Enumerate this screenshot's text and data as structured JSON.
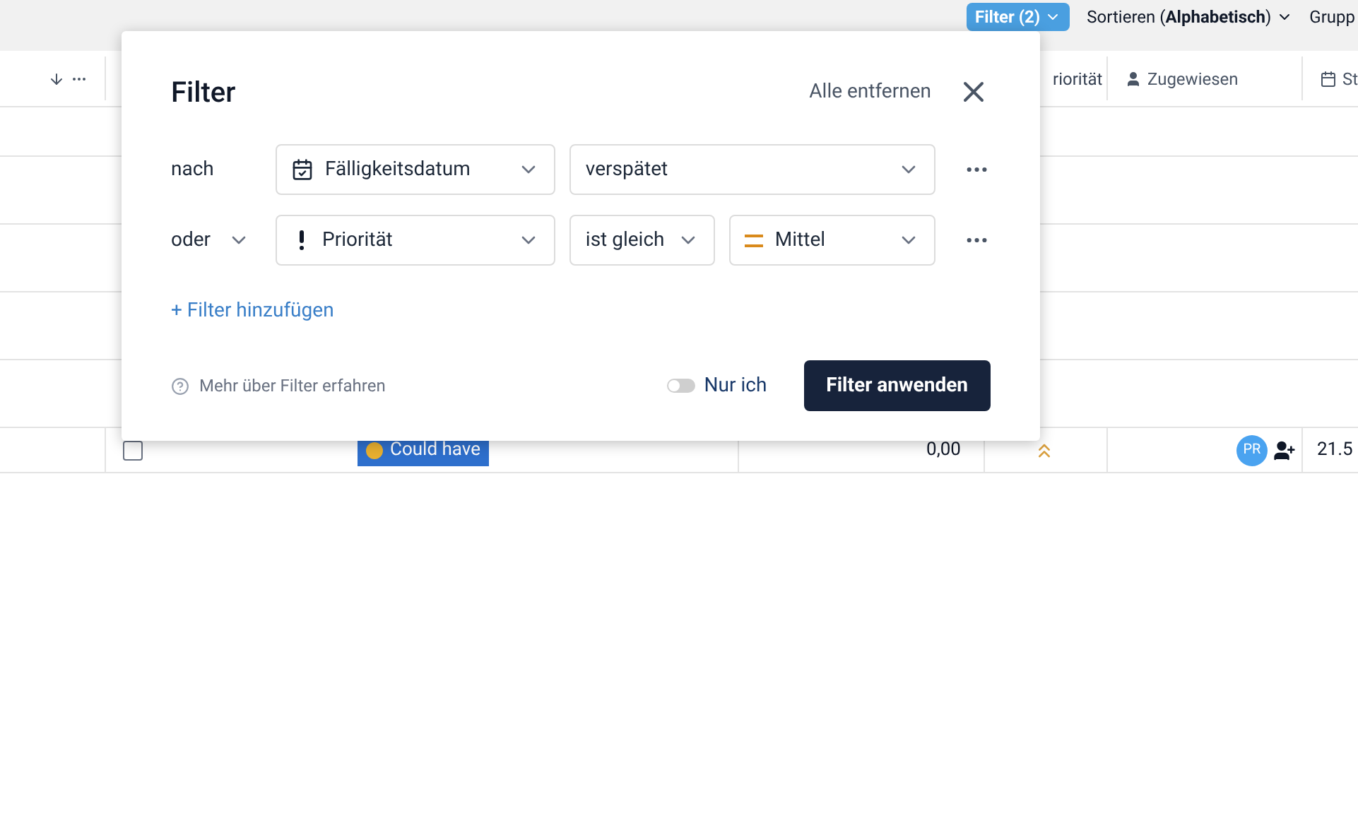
{
  "toolbar": {
    "filter_button": "Filter (2)",
    "sort_button": "Sortieren (**Alphabetisch**)",
    "group_button": "Grupp"
  },
  "table": {
    "columns": [
      "",
      "",
      "",
      "",
      "riorität",
      "Zugewiesen",
      "St"
    ],
    "row": {
      "checked": false,
      "tag": "Could have",
      "amount": "0,00",
      "assignee": "PR",
      "date": "21.5"
    }
  },
  "filter_dialog": {
    "title": "Filter",
    "remove_all": "Alle entfernen",
    "conditions": [
      {
        "kind": "date",
        "connector": "nach",
        "connector_dropdown": false,
        "field": "Fälligkeitsdatum",
        "value": "verspätet"
      },
      {
        "kind": "priority",
        "connector": "oder",
        "connector_dropdown": true,
        "field": "Priorität",
        "operator": "ist gleich",
        "value": "Mittel"
      }
    ],
    "add_filter": "+ Filter hinzufügen",
    "help": "Mehr über Filter erfahren",
    "only_me": {
      "label": "Nur ich",
      "on": false
    },
    "apply": "Filter anwenden"
  }
}
